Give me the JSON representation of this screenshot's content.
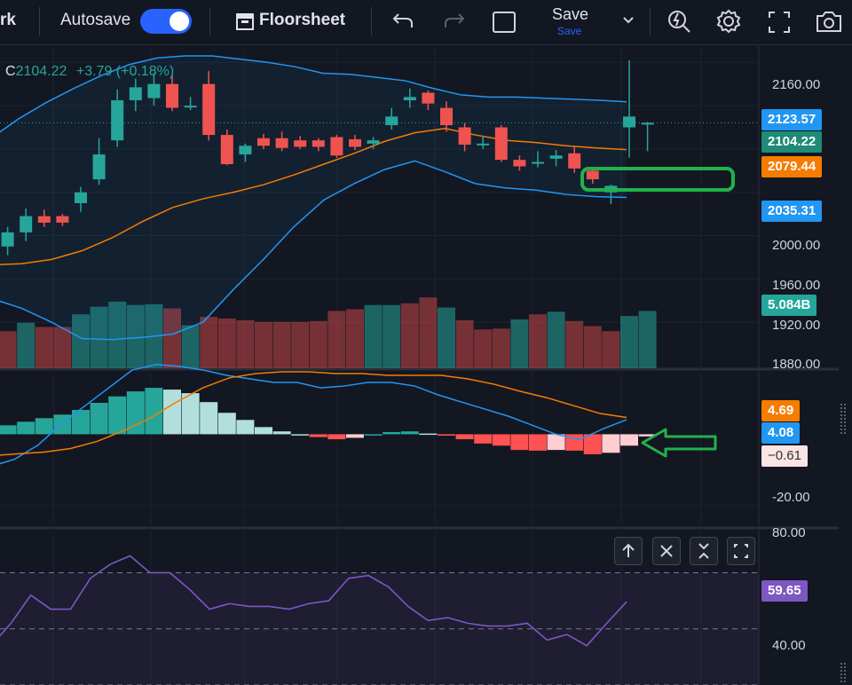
{
  "toolbar": {
    "workspace_partial": "rk",
    "autosave_label": "Autosave",
    "autosave_on": true,
    "floorsheet_label": "Floorsheet",
    "save_label": "Save",
    "save_sub_label": "Save"
  },
  "legend": {
    "close_prefix": "C",
    "close_value": "2104.22",
    "change": "+3.79 (+0.18%)"
  },
  "price_axis": {
    "ticks": [
      "2160.00",
      "2000.00",
      "1960.00",
      "1920.00",
      "1880.00"
    ],
    "tags": {
      "upper_band": "2123.57",
      "last_price": "2104.22",
      "basis": "2079.44",
      "lower_band": "2035.31",
      "volume": "5.084B"
    }
  },
  "macd_axis": {
    "ticks": [
      "-20.00"
    ],
    "tags": {
      "signal": "4.69",
      "macd": "4.08",
      "histogram": "−0.61"
    }
  },
  "rsi_axis": {
    "ticks": [
      "80.00",
      "40.00"
    ],
    "tags": {
      "rsi": "59.65"
    }
  },
  "colors": {
    "background": "#131722",
    "up": "#26a69a",
    "down": "#ef5350",
    "band_blue": "#2196f3",
    "basis_orange": "#f57c00",
    "rsi_purple": "#7e57c2",
    "annotation_green": "#22b14c"
  },
  "icons": [
    "undo-icon",
    "redo-icon",
    "layout-square-icon",
    "chevron-down-icon",
    "quick-search-icon",
    "settings-icon",
    "fullscreen-icon",
    "camera-icon",
    "floorsheet-icon",
    "arrow-up-icon",
    "close-icon",
    "collapse-icon",
    "restore-icon"
  ],
  "chart_data": [
    {
      "type": "candlestick",
      "title": "",
      "ylim": [
        1880,
        2175
      ],
      "candles": [
        {
          "o": 1970,
          "h": 1990,
          "l": 1965,
          "c": 1985
        },
        {
          "o": 1990,
          "h": 2008,
          "l": 1982,
          "c": 2003
        },
        {
          "o": 2003,
          "h": 2025,
          "l": 1995,
          "c": 2018
        },
        {
          "o": 2018,
          "h": 2024,
          "l": 2008,
          "c": 2012
        },
        {
          "o": 2018,
          "h": 2020,
          "l": 2009,
          "c": 2012
        },
        {
          "o": 2030,
          "h": 2045,
          "l": 2022,
          "c": 2040
        },
        {
          "o": 2052,
          "h": 2090,
          "l": 2047,
          "c": 2075
        },
        {
          "o": 2088,
          "h": 2135,
          "l": 2082,
          "c": 2125
        },
        {
          "o": 2125,
          "h": 2145,
          "l": 2115,
          "c": 2137
        },
        {
          "o": 2127,
          "h": 2150,
          "l": 2120,
          "c": 2140
        },
        {
          "o": 2140,
          "h": 2148,
          "l": 2115,
          "c": 2118
        },
        {
          "o": 2120,
          "h": 2128,
          "l": 2116,
          "c": 2120
        },
        {
          "o": 2140,
          "h": 2152,
          "l": 2088,
          "c": 2093
        },
        {
          "o": 2093,
          "h": 2098,
          "l": 2065,
          "c": 2066
        },
        {
          "o": 2075,
          "h": 2085,
          "l": 2068,
          "c": 2083
        },
        {
          "o": 2090,
          "h": 2094,
          "l": 2080,
          "c": 2083
        },
        {
          "o": 2090,
          "h": 2096,
          "l": 2078,
          "c": 2081
        },
        {
          "o": 2088,
          "h": 2092,
          "l": 2080,
          "c": 2082
        },
        {
          "o": 2088,
          "h": 2090,
          "l": 2078,
          "c": 2082
        },
        {
          "o": 2091,
          "h": 2093,
          "l": 2072,
          "c": 2074
        },
        {
          "o": 2089,
          "h": 2093,
          "l": 2079,
          "c": 2082
        },
        {
          "o": 2085,
          "h": 2091,
          "l": 2080,
          "c": 2088
        },
        {
          "o": 2102,
          "h": 2118,
          "l": 2098,
          "c": 2110
        },
        {
          "o": 2125,
          "h": 2136,
          "l": 2118,
          "c": 2128
        },
        {
          "o": 2132,
          "h": 2134,
          "l": 2116,
          "c": 2122
        },
        {
          "o": 2118,
          "h": 2124,
          "l": 2096,
          "c": 2102
        },
        {
          "o": 2100,
          "h": 2104,
          "l": 2078,
          "c": 2084
        },
        {
          "o": 2085,
          "h": 2092,
          "l": 2080,
          "c": 2085
        },
        {
          "o": 2100,
          "h": 2102,
          "l": 2068,
          "c": 2070
        },
        {
          "o": 2070,
          "h": 2074,
          "l": 2060,
          "c": 2064
        },
        {
          "o": 2067,
          "h": 2078,
          "l": 2063,
          "c": 2068
        },
        {
          "o": 2071,
          "h": 2079,
          "l": 2064,
          "c": 2074
        },
        {
          "o": 2076,
          "h": 2082,
          "l": 2058,
          "c": 2062
        },
        {
          "o": 2060,
          "h": 2063,
          "l": 2048,
          "c": 2052
        },
        {
          "o": 2040,
          "h": 2047,
          "l": 2029,
          "c": 2046
        },
        {
          "o": 2100,
          "h": 2162,
          "l": 2072,
          "c": 2110
        },
        {
          "o": 2104,
          "h": 2105,
          "l": 2078,
          "c": 2104.22
        }
      ],
      "upper_band": [
        2090,
        2108,
        2123,
        2136,
        2148,
        2158,
        2164,
        2166,
        2166,
        2163,
        2160,
        2156,
        2150,
        2149,
        2146,
        2143,
        2136,
        2130,
        2128,
        2128,
        2127,
        2126,
        2125,
        2123.57
      ],
      "basis": [
        1973,
        1974,
        1978,
        1986,
        1998,
        2013,
        2026,
        2034,
        2040,
        2047,
        2056,
        2066,
        2076,
        2087,
        2095,
        2099,
        2093,
        2088,
        2086,
        2083,
        2081,
        2079.44
      ],
      "lower_band": [
        1942,
        1933,
        1920,
        1905,
        1904,
        1906,
        1909,
        1920,
        1950,
        1978,
        2008,
        2033,
        2048,
        2061,
        2069,
        2059,
        2048,
        2044,
        2042,
        2038,
        2036,
        2035.31
      ]
    },
    {
      "type": "bar",
      "title": "Volume",
      "last_value": "5.084B",
      "directions": [
        "up",
        "down",
        "up",
        "down",
        "down",
        "up",
        "up",
        "up",
        "up",
        "up",
        "down",
        "up",
        "down",
        "down",
        "down",
        "down",
        "down",
        "down",
        "down",
        "down",
        "down",
        "up",
        "up",
        "down",
        "down",
        "up",
        "down",
        "down",
        "down",
        "up",
        "down",
        "up",
        "down",
        "down",
        "down",
        "up",
        "up"
      ],
      "relative_heights": [
        0.43,
        0.44,
        0.54,
        0.49,
        0.49,
        0.64,
        0.73,
        0.79,
        0.75,
        0.76,
        0.71,
        0.51,
        0.61,
        0.59,
        0.57,
        0.55,
        0.55,
        0.55,
        0.56,
        0.68,
        0.7,
        0.75,
        0.75,
        0.77,
        0.84,
        0.72,
        0.57,
        0.46,
        0.47,
        0.58,
        0.64,
        0.67,
        0.56,
        0.5,
        0.44,
        0.62,
        0.68
      ]
    },
    {
      "type": "bar",
      "title": "MACD",
      "ylim": [
        -25,
        16
      ],
      "histogram": [
        1.5,
        2.5,
        3.5,
        4.5,
        5.5,
        6.8,
        8.8,
        10.6,
        12.0,
        13.0,
        12.5,
        11.5,
        9.0,
        6.0,
        4.0,
        2.0,
        0.8,
        0.0,
        -0.8,
        -1.4,
        -1.0,
        0.0,
        0.6,
        0.8,
        0.2,
        -0.4,
        -1.4,
        -2.6,
        -3.2,
        -4.4,
        -4.6,
        -4.4,
        -4.6,
        -5.6,
        -5.2,
        -3.2,
        -0.61
      ],
      "macd_line": [
        -9,
        -7,
        -3,
        3,
        8,
        13,
        18,
        19.5,
        19,
        18,
        16.5,
        15.5,
        14.5,
        14.5,
        13,
        13.5,
        14.5,
        14.5,
        13.5,
        11,
        9,
        7,
        5,
        2.5,
        0,
        -1.5,
        1.5,
        4.08
      ],
      "signal_line": [
        -6,
        -5.5,
        -5,
        -4,
        -2,
        1,
        4.5,
        9,
        13,
        15.8,
        17,
        17.5,
        17.5,
        17,
        17,
        16.5,
        16.5,
        16.5,
        15.5,
        14,
        12,
        10.2,
        8,
        5.8,
        4.69
      ]
    },
    {
      "type": "line",
      "title": "RSI",
      "ylim": [
        30,
        85
      ],
      "levels": [
        70,
        50,
        30
      ],
      "values": [
        44,
        52,
        62,
        57,
        57,
        68,
        73,
        76,
        70,
        70,
        64,
        57,
        59,
        58,
        58,
        57,
        59,
        60,
        68,
        69,
        65,
        58,
        53,
        54,
        52,
        51,
        51,
        52,
        46,
        48,
        44,
        52,
        59.65
      ]
    }
  ]
}
